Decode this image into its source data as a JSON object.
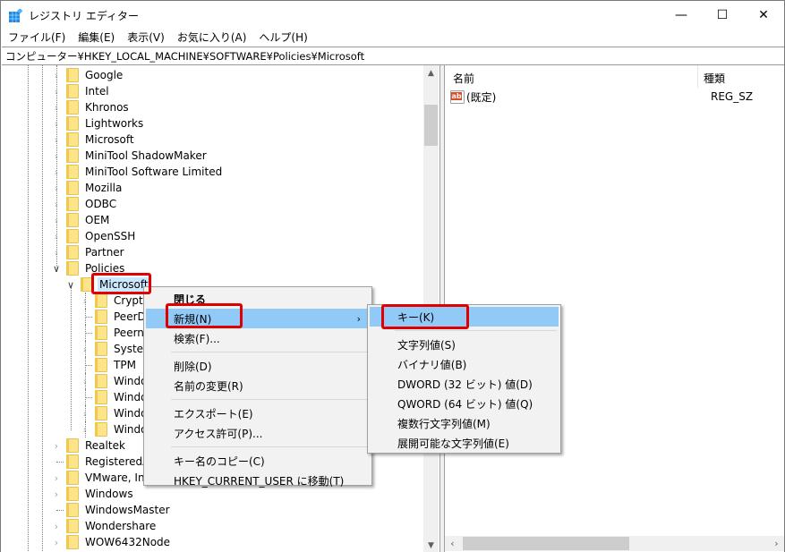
{
  "window": {
    "title": "レジストリ エディター",
    "controls": {
      "minimize": "—",
      "maximize": "☐",
      "close": "✕"
    }
  },
  "menubar": [
    "ファイル(F)",
    "編集(E)",
    "表示(V)",
    "お気に入り(A)",
    "ヘルプ(H)"
  ],
  "address": "コンピューター¥HKEY_LOCAL_MACHINE¥SOFTWARE¥Policies¥Microsoft",
  "tree": {
    "items": [
      {
        "label": "Google",
        "expander": "collapsed"
      },
      {
        "label": "Intel",
        "expander": "collapsed"
      },
      {
        "label": "Khronos",
        "expander": "collapsed"
      },
      {
        "label": "Lightworks",
        "expander": "collapsed"
      },
      {
        "label": "Microsoft",
        "expander": "collapsed"
      },
      {
        "label": "MiniTool ShadowMaker",
        "expander": "collapsed"
      },
      {
        "label": "MiniTool Software Limited",
        "expander": "collapsed"
      },
      {
        "label": "Mozilla",
        "expander": "collapsed"
      },
      {
        "label": "ODBC",
        "expander": "collapsed"
      },
      {
        "label": "OEM",
        "expander": "collapsed"
      },
      {
        "label": "OpenSSH",
        "expander": "collapsed"
      },
      {
        "label": "Partner",
        "expander": "collapsed"
      },
      {
        "label": "Policies",
        "expander": "expanded"
      }
    ],
    "selected": {
      "label": "Microsoft",
      "expander": "expanded"
    },
    "children": [
      {
        "label": "Cryptography",
        "visible": "Crypto",
        "expander": "collapsed"
      },
      {
        "label": "PeerDist",
        "visible": "PeerDi",
        "expander": "none"
      },
      {
        "label": "Peernet",
        "visible": "Peerne",
        "expander": "none"
      },
      {
        "label": "SystemCertificates",
        "visible": "System",
        "expander": "collapsed"
      },
      {
        "label": "TPM",
        "visible": "TPM",
        "expander": "none"
      },
      {
        "label": "Windows",
        "visible": "Windo",
        "expander": "collapsed"
      },
      {
        "label": "Windows Advanced Threat Protection",
        "visible": "Windo",
        "expander": "none"
      },
      {
        "label": "Windows Defender",
        "visible": "Windo",
        "expander": "collapsed"
      },
      {
        "label": "Windows NT",
        "visible": "Windo",
        "expander": "collapsed"
      }
    ],
    "after": [
      {
        "label": "Realtek",
        "expander": "collapsed"
      },
      {
        "label": "RegisteredApplications",
        "visible": "RegisteredAp",
        "expander": "none"
      },
      {
        "label": "VMware, Inc.",
        "expander": "collapsed"
      },
      {
        "label": "Windows",
        "expander": "collapsed"
      },
      {
        "label": "WindowsMaster",
        "expander": "none"
      },
      {
        "label": "Wondershare",
        "expander": "collapsed"
      },
      {
        "label": "WOW6432Node",
        "expander": "collapsed"
      }
    ]
  },
  "list": {
    "columns": {
      "name": "名前",
      "type": "種類"
    },
    "rows": [
      {
        "name": "(既定)",
        "type": "REG_SZ",
        "icon": "string-value-icon"
      }
    ]
  },
  "context_menu": {
    "items": [
      {
        "label": "閉じる",
        "bold": true
      },
      {
        "label": "新規(N)",
        "highlighted": true,
        "submenu": true
      },
      {
        "label": "検索(F)..."
      },
      {
        "separator": true
      },
      {
        "label": "削除(D)"
      },
      {
        "label": "名前の変更(R)"
      },
      {
        "separator": true
      },
      {
        "label": "エクスポート(E)"
      },
      {
        "label": "アクセス許可(P)..."
      },
      {
        "separator": true
      },
      {
        "label": "キー名のコピー(C)"
      },
      {
        "label": "HKEY_CURRENT_USER に移動(T)"
      }
    ]
  },
  "submenu": {
    "items": [
      {
        "label": "キー(K)",
        "highlighted": true
      },
      {
        "separator": true
      },
      {
        "label": "文字列値(S)"
      },
      {
        "label": "バイナリ値(B)"
      },
      {
        "label": "DWORD (32 ビット) 値(D)"
      },
      {
        "label": "QWORD (64 ビット) 値(Q)"
      },
      {
        "label": "複数行文字列値(M)"
      },
      {
        "label": "展開可能な文字列値(E)"
      }
    ]
  },
  "colors": {
    "highlight": "#91c9f7",
    "selection": "#cce8ff",
    "annotation_red": "#e00000",
    "folder": "#fde38a"
  }
}
